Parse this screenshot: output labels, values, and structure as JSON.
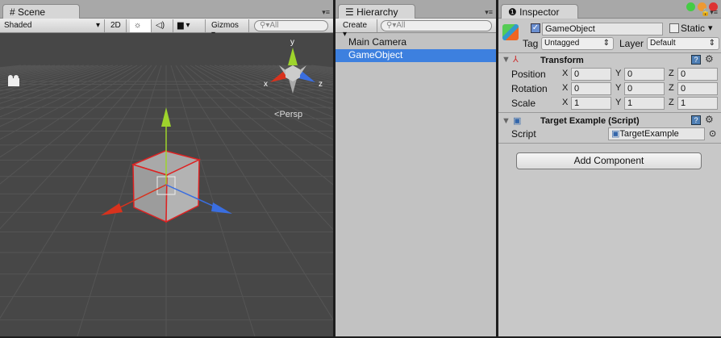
{
  "scene": {
    "tab": "Scene",
    "shading": "Shaded",
    "mode_2d": "2D",
    "gizmos": "Gizmos",
    "search_placeholder": "All",
    "persp": "Persp",
    "axis_x": "x",
    "axis_y": "y",
    "axis_z": "z"
  },
  "hierarchy": {
    "tab": "Hierarchy",
    "create": "Create",
    "search_placeholder": "All",
    "items": [
      {
        "label": "Main Camera",
        "selected": false
      },
      {
        "label": "GameObject",
        "selected": true
      }
    ]
  },
  "inspector": {
    "tab": "Inspector",
    "object_name": "GameObject",
    "active": true,
    "static_label": "Static",
    "static": false,
    "tag_label": "Tag",
    "tag": "Untagged",
    "layer_label": "Layer",
    "layer": "Default",
    "transform": {
      "title": "Transform",
      "rows": [
        {
          "label": "Position",
          "x": "0",
          "y": "0",
          "z": "0"
        },
        {
          "label": "Rotation",
          "x": "0",
          "y": "0",
          "z": "0"
        },
        {
          "label": "Scale",
          "x": "1",
          "y": "1",
          "z": "1"
        }
      ],
      "x": "X",
      "y": "Y",
      "z": "Z"
    },
    "script_component": {
      "title": "Target Example (Script)",
      "script_label": "Script",
      "script_value": "TargetExample"
    },
    "add_component": "Add Component"
  },
  "colors": {
    "selection": "#3d80df",
    "x_axis": "#d8321d",
    "y_axis": "#9ed42c",
    "z_axis": "#3a6ee0"
  }
}
